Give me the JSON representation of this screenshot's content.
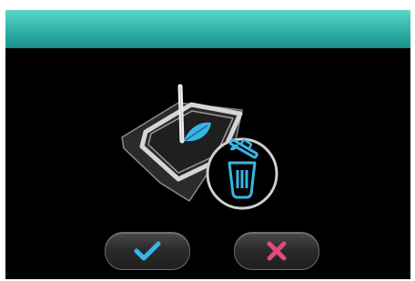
{
  "header": {
    "title": ""
  },
  "dialog": {
    "illustration_icons": [
      "hoop-fabric-icon",
      "needle-icon",
      "leaf-embroidery-icon",
      "delete-trash-icon"
    ]
  },
  "buttons": {
    "confirm_icon": "checkmark-icon",
    "cancel_icon": "x-icon"
  },
  "colors": {
    "header_teal": "#2fb1a8",
    "accent_blue": "#3ab4e6",
    "confirm_blue": "#38b6e8",
    "cancel_pink": "#e5487f"
  }
}
